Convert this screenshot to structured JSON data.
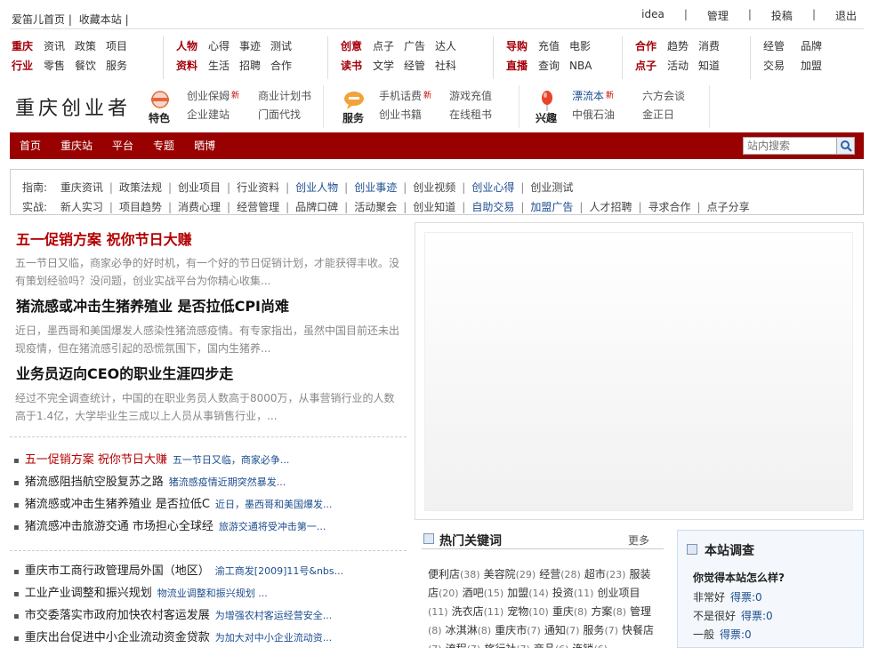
{
  "topbar": {
    "left": [
      "爱笛儿首页",
      "|",
      "收藏本站",
      "|"
    ],
    "right": [
      "idea",
      "管理",
      "投稿",
      "退出"
    ]
  },
  "categories": [
    {
      "rows": [
        {
          "label": "重庆",
          "links": [
            "资讯",
            "政策",
            "项目"
          ]
        },
        {
          "label": "行业",
          "links": [
            "零售",
            "餐饮",
            "服务"
          ]
        }
      ]
    },
    {
      "rows": [
        {
          "label": "人物",
          "links": [
            "心得",
            "事迹",
            "测试"
          ]
        },
        {
          "label": "资料",
          "links": [
            "生活",
            "招聘",
            "合作"
          ]
        }
      ]
    },
    {
      "rows": [
        {
          "label": "创意",
          "links": [
            "点子",
            "广告",
            "达人"
          ]
        },
        {
          "label": "读书",
          "links": [
            "文学",
            "经管",
            "社科"
          ]
        }
      ]
    },
    {
      "rows": [
        {
          "label": "导购",
          "links": [
            "充值",
            "电影"
          ]
        },
        {
          "label": "直播",
          "links": [
            "查询",
            "NBA"
          ]
        }
      ]
    },
    {
      "rows": [
        {
          "label": "合作",
          "links": [
            "趋势",
            "消费"
          ]
        },
        {
          "label": "点子",
          "links": [
            "活动",
            "知道"
          ]
        }
      ]
    },
    {
      "rows": [
        {
          "label": "",
          "links": [
            "经管",
            "品牌"
          ]
        },
        {
          "label": "",
          "links": [
            "交易",
            "加盟"
          ]
        }
      ]
    }
  ],
  "logo": "重庆创业者",
  "features": [
    {
      "label": "特色",
      "col1": [
        "创业保姆",
        "企业建站"
      ],
      "col1_new": [
        true,
        false
      ],
      "col2": [
        "商业计划书",
        "门面代找"
      ]
    },
    {
      "label": "服务",
      "col1": [
        "手机话费",
        "创业书籍"
      ],
      "col1_new": [
        true,
        false
      ],
      "col2": [
        "游戏充值",
        "在线租书"
      ]
    },
    {
      "label": "兴趣",
      "col1": [
        "漂流本",
        "中俄石油"
      ],
      "col1_new": [
        true,
        false
      ],
      "col2": [
        "六方会谈",
        "金正日"
      ]
    }
  ],
  "new_badge": "新",
  "mainnav": {
    "items": [
      "首页",
      "重庆站",
      "平台",
      "专题",
      "晒博"
    ],
    "search_placeholder": "站内搜索"
  },
  "guide": {
    "row1": {
      "key": "指南:",
      "links": [
        "重庆资讯",
        "政策法规",
        "创业项目",
        "行业资料",
        "创业人物",
        "创业事迹",
        "创业视频",
        "创业心得",
        "创业测试"
      ]
    },
    "row2": {
      "key": "实战:",
      "links": [
        "新人实习",
        "项目趋势",
        "消费心理",
        "经营管理",
        "品牌口碑",
        "活动聚会",
        "创业知道",
        "自助交易",
        "加盟广告",
        "人才招聘",
        "寻求合作",
        "点子分享"
      ]
    }
  },
  "headlines": [
    {
      "title": "五一促销方案 祝你节日大赚",
      "summary": "五一节日又临，商家必争的好时机，有一个好的节日促销计划，才能获得丰收。没有策划经验吗？没问题，创业实战平台为你精心收集..."
    },
    {
      "title": "猪流感或冲击生猪养殖业 是否拉低CPI尚难",
      "summary": "近日，墨西哥和美国爆发人感染性猪流感疫情。有专家指出，虽然中国目前还未出现疫情，但在猪流感引起的恐慌氛围下，国内生猪养..."
    },
    {
      "title": "业务员迈向CEO的职业生涯四步走",
      "summary": "经过不完全调查统计，中国的在职业务员人数高于8000万，从事营销行业的人数高于1.4亿，大学毕业生三成以上人员从事销售行业，..."
    }
  ],
  "list1": [
    {
      "main": "五一促销方案 祝你节日大赚",
      "sub": "五一节日又临，商家必争..."
    },
    {
      "main": "猪流感阻挡航空股复苏之路",
      "sub": "猪流感疫情近期突然暴发..."
    },
    {
      "main": "猪流感或冲击生猪养殖业 是否拉低C",
      "sub": "近日，墨西哥和美国爆发..."
    },
    {
      "main": "猪流感冲击旅游交通 市场担心全球经",
      "sub": "旅游交通将受冲击第一..."
    }
  ],
  "list2": [
    {
      "main": "重庆市工商行政管理局外国（地区）",
      "sub": "渝工商发[2009]11号&nbs..."
    },
    {
      "main": "工业产业调整和振兴规划",
      "sub": "物流业调整和振兴规划 ..."
    },
    {
      "main": "市交委落实市政府加快农村客运发展",
      "sub": "为增强农村客运经营安全..."
    },
    {
      "main": "重庆出台促进中小企业流动资金贷款",
      "sub": "为加大对中小企业流动资..."
    }
  ],
  "bullet": "▪",
  "hot": {
    "title": "热门关键词",
    "more": "更多",
    "keywords": [
      {
        "w": "便利店",
        "c": "(38)"
      },
      {
        "w": "美容院",
        "c": "(29)"
      },
      {
        "w": "经营",
        "c": "(28)"
      },
      {
        "w": "超市",
        "c": "(23)"
      },
      {
        "w": "服装店",
        "c": "(20)"
      },
      {
        "w": "酒吧",
        "c": "(15)"
      },
      {
        "w": "加盟",
        "c": "(14)"
      },
      {
        "w": "投资",
        "c": "(11)"
      },
      {
        "w": "创业项目",
        "c": "(11)"
      },
      {
        "w": "洗衣店",
        "c": "(11)"
      },
      {
        "w": "宠物",
        "c": "(10)"
      },
      {
        "w": "重庆",
        "c": "(8)"
      },
      {
        "w": "方案",
        "c": "(8)"
      },
      {
        "w": "管理",
        "c": "(8)"
      },
      {
        "w": "冰淇淋",
        "c": "(8)"
      },
      {
        "w": "重庆市",
        "c": "(7)"
      },
      {
        "w": "通知",
        "c": "(7)"
      },
      {
        "w": "服务",
        "c": "(7)"
      },
      {
        "w": "快餐店",
        "c": "(7)"
      },
      {
        "w": "流程",
        "c": "(7)"
      },
      {
        "w": "旅行社",
        "c": "(7)"
      },
      {
        "w": "商品",
        "c": "(6)"
      },
      {
        "w": "连锁",
        "c": "(6)"
      }
    ]
  },
  "survey": {
    "title": "本站调查",
    "question": "你觉得本站怎么样?",
    "options": [
      {
        "label": "非常好",
        "votes": "得票:0"
      },
      {
        "label": "不是很好",
        "votes": "得票:0"
      },
      {
        "label": "一般",
        "votes": "得票:0"
      }
    ]
  }
}
